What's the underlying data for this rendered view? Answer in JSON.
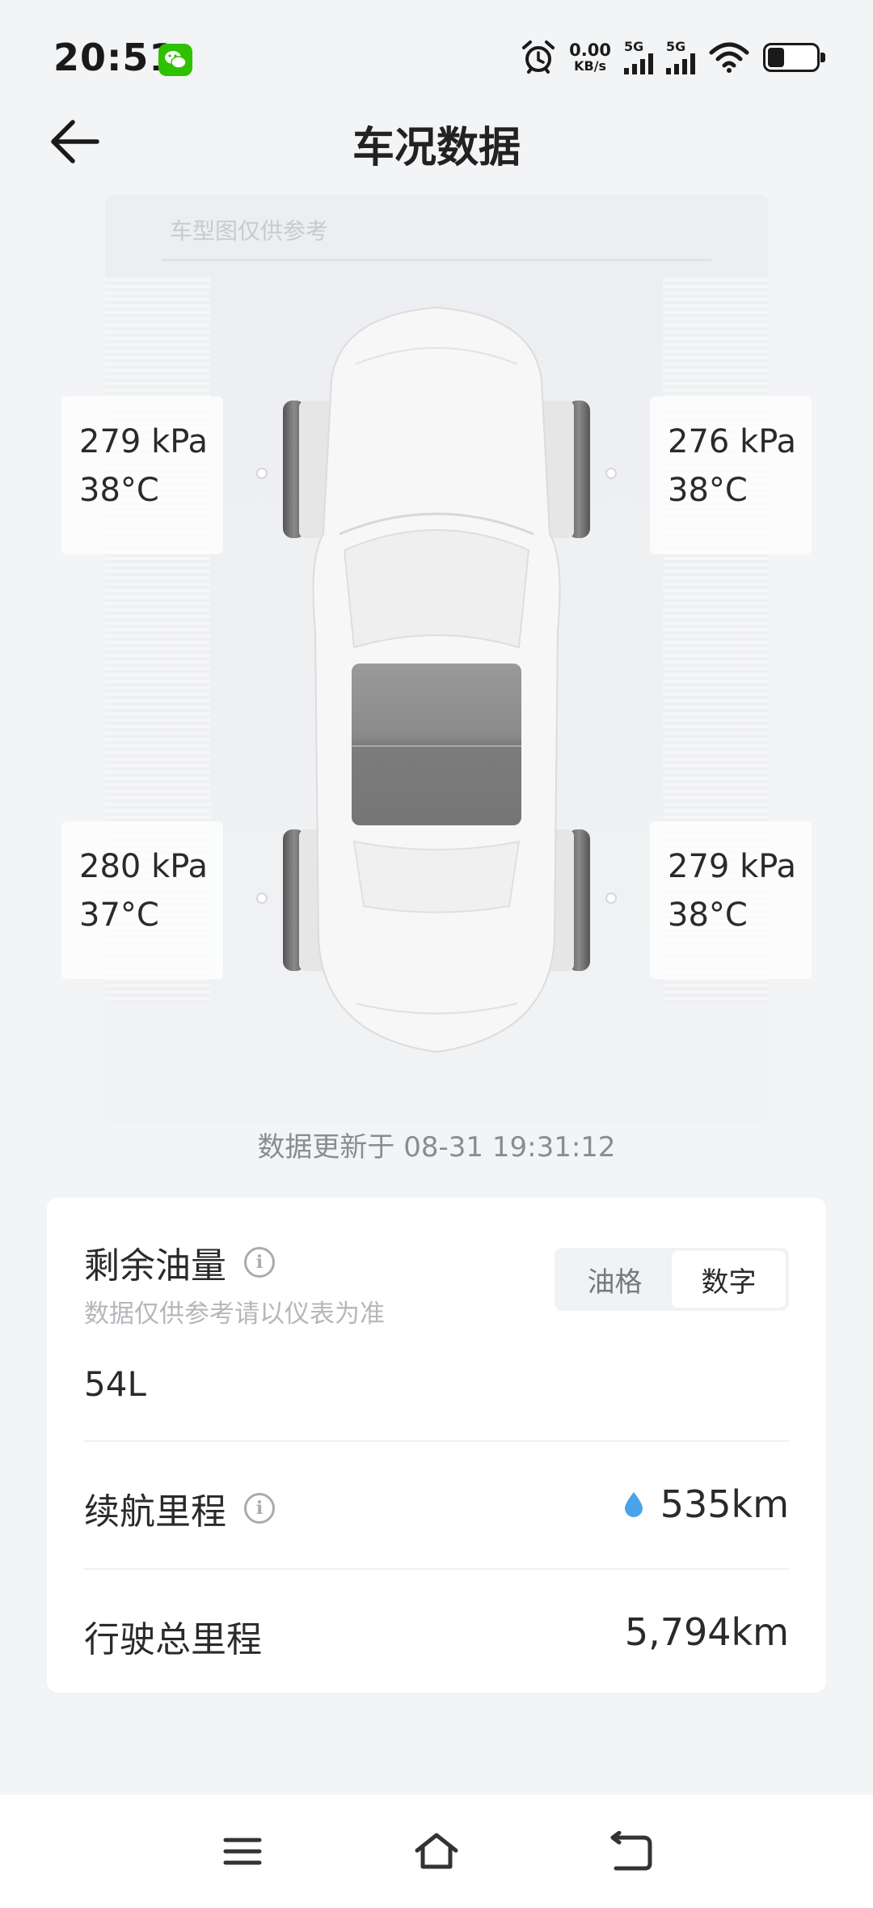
{
  "status_bar": {
    "time": "20:51",
    "speed_value": "0.00",
    "speed_unit": "KB/s",
    "sim1": "5G",
    "sim2": "5G"
  },
  "header": {
    "title": "车况数据"
  },
  "car": {
    "reference_note": "车型图仅供参考",
    "tires": {
      "front_left": {
        "pressure": "279 kPa",
        "temp": "38°C"
      },
      "front_right": {
        "pressure": "276 kPa",
        "temp": "38°C"
      },
      "rear_left": {
        "pressure": "280 kPa",
        "temp": "37°C"
      },
      "rear_right": {
        "pressure": "279 kPa",
        "temp": "38°C"
      }
    },
    "update_time": "数据更新于 08-31 19:31:12"
  },
  "fuel": {
    "title": "剩余油量",
    "subtitle": "数据仅供参考请以仪表为准",
    "value": "54L",
    "toggle_options": [
      "油格",
      "数字"
    ],
    "selected": "数字"
  },
  "range": {
    "label": "续航里程",
    "value": "535km"
  },
  "odometer": {
    "label": "行驶总里程",
    "value": "5,794km"
  },
  "colors": {
    "background": "#f3f4f6",
    "card": "#ffffff",
    "drop_blue": "#4aa3e8",
    "wechat_green": "#2dc100"
  }
}
